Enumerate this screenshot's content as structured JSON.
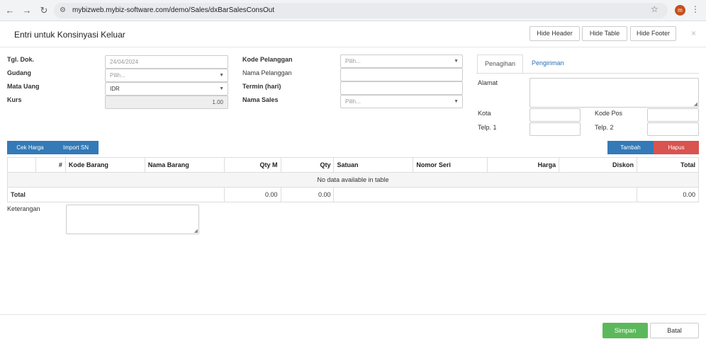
{
  "browser": {
    "back_icon": "arrow-left-icon",
    "url": "mybizweb.mybiz-software.com/demo/Sales/dxBarSalesConsOut",
    "avatar_letter": "m"
  },
  "modal": {
    "title": "Entri untuk Konsinyasi Keluar",
    "hide_header": "Hide Header",
    "hide_table": "Hide Table",
    "hide_footer": "Hide Footer",
    "close": "×"
  },
  "form": {
    "tgl_label": "Tgl. Dok.",
    "tgl_value": "24/04/2024",
    "gudang_label": "Gudang",
    "gudang_placeholder": "Pilih...",
    "mata_uang_label": "Mata Uang",
    "mata_uang_value": "IDR",
    "kurs_label": "Kurs",
    "kurs_value": "1.00",
    "kode_pelanggan_label": "Kode Pelanggan",
    "kode_pelanggan_placeholder": "Pilih...",
    "nama_pelanggan_label": "Nama Pelanggan",
    "termin_label": "Termin (hari)",
    "nama_sales_label": "Nama Sales",
    "nama_sales_placeholder": "Pilih..."
  },
  "address": {
    "tabs": [
      "Penagihan",
      "Pengiriman"
    ],
    "alamat_label": "Alamat",
    "kota_label": "Kota",
    "kode_pos_label": "Kode Pos",
    "telp1_label": "Telp. 1",
    "telp2_label": "Telp. 2"
  },
  "actions": {
    "cek_harga": "Cek Harga",
    "import_sn": "Import SN",
    "tambah": "Tambah",
    "hapus": "Hapus"
  },
  "table": {
    "columns": [
      "#",
      "Kode Barang",
      "Nama Barang",
      "Qty M",
      "Qty",
      "Satuan",
      "Nomor Seri",
      "Harga",
      "Diskon",
      "Total"
    ],
    "empty_message": "No data available in table",
    "total_label": "Total",
    "total_qty_m": "0.00",
    "total_qty": "0.00",
    "total_total": "0.00"
  },
  "footer": {
    "keterangan_label": "Keterangan",
    "simpan": "Simpan",
    "batal": "Batal"
  },
  "colors": {
    "primary": "#337ab7",
    "danger": "#d9534f",
    "success": "#5cb85c"
  }
}
